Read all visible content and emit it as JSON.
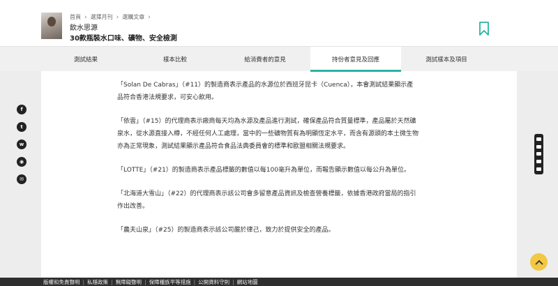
{
  "breadcrumb": [
    "首頁",
    "選擇月刊",
    "選購文章"
  ],
  "header": {
    "title": "飲水思源",
    "subtitle": "30款瓶裝水口味、礦物、安全檢測"
  },
  "tabs": [
    {
      "label": "測試結果"
    },
    {
      "label": "樣本比較"
    },
    {
      "label": "給消費者的意見"
    },
    {
      "label": "持份者意見及回應",
      "active": true
    },
    {
      "label": "測試樣本及項目"
    }
  ],
  "paragraphs": [
    "「Solan De Cabras」（#11）的製造商表示產品的水源位於西班牙昆卡（Cuenca），本會測試結果顯示產品符合香港法規要求，可安心飲用。",
    "「依雲」（#15）的代理商表示廠商每天均為水源及產品進行測試，確保產品符合質量標準，產品屬於天然礦泉水，從水源直接入樽，不經任何人工處理，當中的一些礦物質有為明顯恆定水平，而含有源頭的本土微生物亦為正常現象，測試結果顯示產品符合食品法典委員會的標準和歐盟相關法規要求。",
    "「LOTTE」（#21）的製造商表示產品標籤的數值以每100毫升為單位，而報告顯示數值以每公升為單位。",
    "「北海道大雪山」（#22）的代理商表示該公司會多留意產品資訊及檢查營養標籤，依據香港政府當局的指引作出改善。",
    "「農夫山泉」（#25）的製造商表示該公司嚴於律己，致力於提供安全的產品。"
  ],
  "share_icons": [
    "facebook-icon",
    "twitter-icon",
    "whatsapp-icon",
    "weibo-icon",
    "email-icon"
  ],
  "footer_links": [
    "版權和免責聲明",
    "私隱政策",
    "無障礙聲明",
    "保障種族平等措施",
    "公開資料守則",
    "網站地圖"
  ],
  "colors": {
    "accent": "#2bb3a3",
    "to_top": "#f2c744"
  }
}
